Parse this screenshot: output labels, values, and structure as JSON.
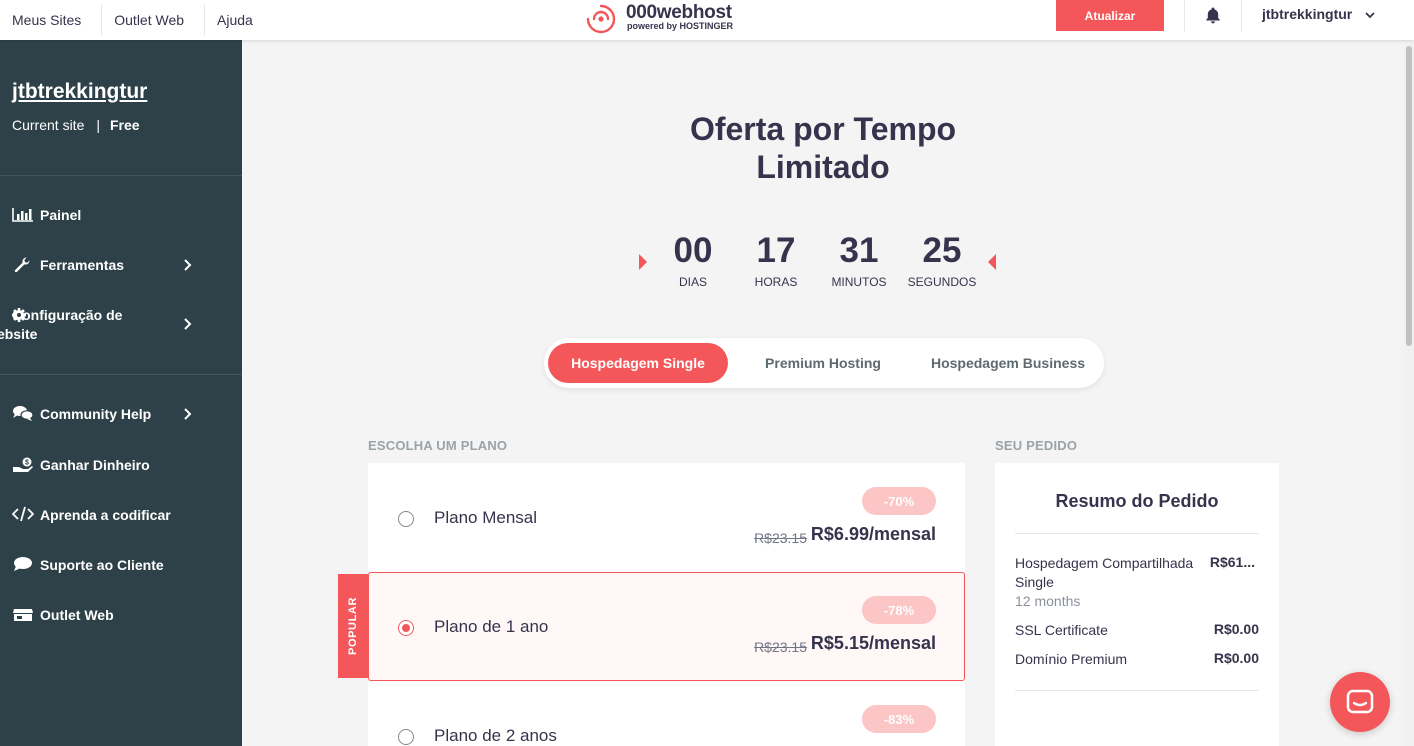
{
  "topbar": {
    "nav": [
      "Meus Sites",
      "Outlet Web",
      "Ajuda"
    ],
    "logo": {
      "name": "000webhost",
      "tagline": "powered by HOSTINGER"
    },
    "upgrade_label": "Atualizar",
    "username": "jtbtrekkingtur"
  },
  "sidebar": {
    "site_name": "jtbtrekkingtur",
    "current_site_label": "Current site",
    "separator": "|",
    "plan": "Free",
    "items": [
      {
        "label": "Painel",
        "icon": "bar-chart-icon",
        "chevron": false
      },
      {
        "label": "Ferramentas",
        "icon": "wrench-icon",
        "chevron": true
      },
      {
        "label": "Configuração de Website",
        "icon": "gear-icon",
        "chevron": true
      },
      {
        "label": "Community Help",
        "icon": "chat-bubbles-icon",
        "chevron": true
      },
      {
        "label": "Ganhar Dinheiro",
        "icon": "money-icon",
        "chevron": false
      },
      {
        "label": "Aprenda a codificar",
        "icon": "code-icon",
        "chevron": false
      },
      {
        "label": "Suporte ao Cliente",
        "icon": "speech-bubble-icon",
        "chevron": false
      },
      {
        "label": "Outlet Web",
        "icon": "store-icon",
        "chevron": false
      }
    ]
  },
  "main": {
    "title": "Oferta por Tempo Limitado",
    "countdown": [
      {
        "value": "00",
        "label": "DIAS"
      },
      {
        "value": "17",
        "label": "HORAS"
      },
      {
        "value": "31",
        "label": "MINUTOS"
      },
      {
        "value": "25",
        "label": "SEGUNDOS"
      }
    ],
    "tabs": [
      {
        "label": "Hospedagem Single",
        "active": true
      },
      {
        "label": "Premium Hosting",
        "active": false
      },
      {
        "label": "Hospedagem Business",
        "active": false
      }
    ],
    "choose_plan_label": "ESCOLHA UM PLANO",
    "order_label": "SEU PEDIDO",
    "popular_label": "POPULAR",
    "plans": [
      {
        "name": "Plano Mensal",
        "discount": "-70%",
        "old_price": "R$23.15",
        "price": "R$6.99/mensal",
        "selected": false
      },
      {
        "name": "Plano de 1 ano",
        "discount": "-78%",
        "old_price": "R$23.15",
        "price": "R$5.15/mensal",
        "selected": true
      },
      {
        "name": "Plano de 2 anos",
        "discount": "-83%",
        "old_price": "",
        "price": "",
        "selected": false
      }
    ],
    "summary": {
      "title": "Resumo do Pedido",
      "rows": [
        {
          "label": "Hospedagem Compartilhada Single",
          "sub": "12 months",
          "value": "R$61..."
        },
        {
          "label": "SSL Certificate",
          "sub": "",
          "value": "R$0.00"
        },
        {
          "label": "Domínio Premium",
          "sub": "",
          "value": "R$0.00"
        }
      ]
    }
  },
  "colors": {
    "accent": "#f4575a",
    "sidebar_bg": "#2e4148",
    "text_dark": "#36344d",
    "badge_pink": "#fcc5c6"
  }
}
